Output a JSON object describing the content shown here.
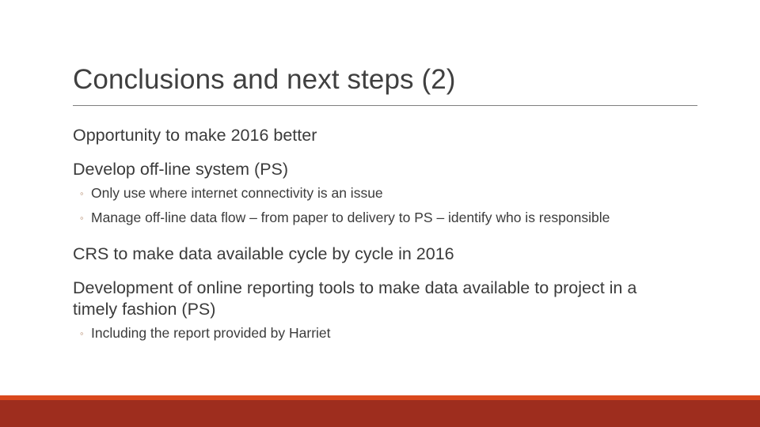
{
  "slide": {
    "title": "Conclusions and next steps (2)",
    "background_color": "#ffffff",
    "title_color": "#404040",
    "body_color": "#3b3b3b",
    "rule_color": "#7f7f7f",
    "bullet_marker_color": "#b08363",
    "bullet_marker_glyph": "◦",
    "content": [
      {
        "level": 1,
        "text": "Opportunity to make 2016 better"
      },
      {
        "level": 1,
        "text": "Develop off-line system (PS)"
      },
      {
        "level": 2,
        "text": "Only use where internet connectivity is an issue"
      },
      {
        "level": 2,
        "text": "Manage off-line data flow – from paper to delivery to PS – identify who is responsible"
      },
      {
        "level": 1,
        "text": "CRS to make data available cycle by cycle in 2016"
      },
      {
        "level": 1,
        "text": "Development of online reporting tools to make data available to project in a timely fashion (PS)"
      },
      {
        "level": 2,
        "text": "Including the report provided by Harriet"
      }
    ]
  },
  "footer": {
    "stripe_color": "#d9481d",
    "band_color": "#9e2d1e"
  }
}
